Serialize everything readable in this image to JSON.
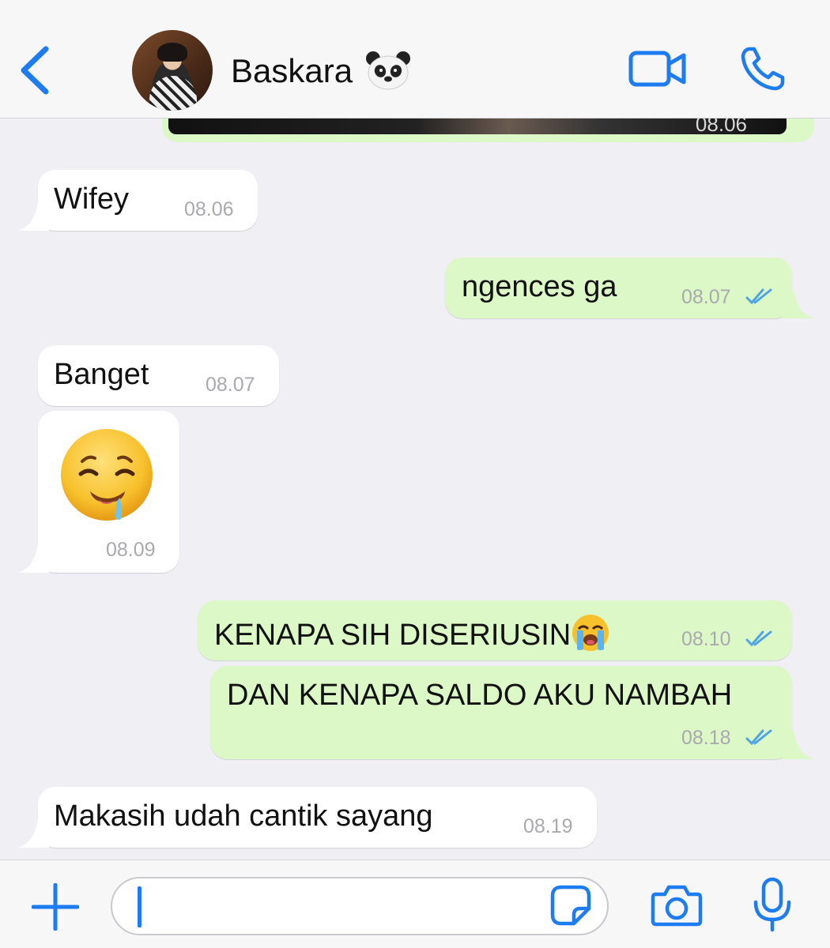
{
  "header": {
    "contact_name": "Baskara",
    "contact_emoji": "panda-face-emoji",
    "icons": {
      "back": "chevron-left-icon",
      "video": "video-call-icon",
      "call": "phone-icon"
    }
  },
  "previous_message": {
    "time": "08.06"
  },
  "messages": [
    {
      "direction": "incoming",
      "text": "Wifey",
      "time": "08.06"
    },
    {
      "direction": "outgoing",
      "text": "ngences ga",
      "time": "08.07",
      "status": "read"
    },
    {
      "direction": "incoming",
      "text": "Banget",
      "time": "08.07"
    },
    {
      "direction": "incoming",
      "emoji": "drooling-face",
      "time": "08.09"
    },
    {
      "direction": "outgoing",
      "text": "KENAPA SIH DISERIUSIN",
      "emoji": "loudly-crying-face",
      "time": "08.10",
      "status": "read"
    },
    {
      "direction": "outgoing",
      "text": "DAN KENAPA SALDO AKU NAMBAH",
      "time": "08.18",
      "status": "read"
    },
    {
      "direction": "incoming",
      "text": "Makasih udah cantik sayang",
      "time": "08.19"
    }
  ],
  "input_bar": {
    "value": "",
    "icons": {
      "attach": "plus-icon",
      "sticker": "sticker-icon",
      "camera": "camera-icon",
      "voice": "microphone-icon"
    }
  },
  "colors": {
    "accent": "#1e7cf2",
    "outgoing_bubble": "#dcf8c6",
    "incoming_bubble": "#ffffff",
    "background": "#efeff4",
    "read_ticks": "#4fa4e8"
  }
}
